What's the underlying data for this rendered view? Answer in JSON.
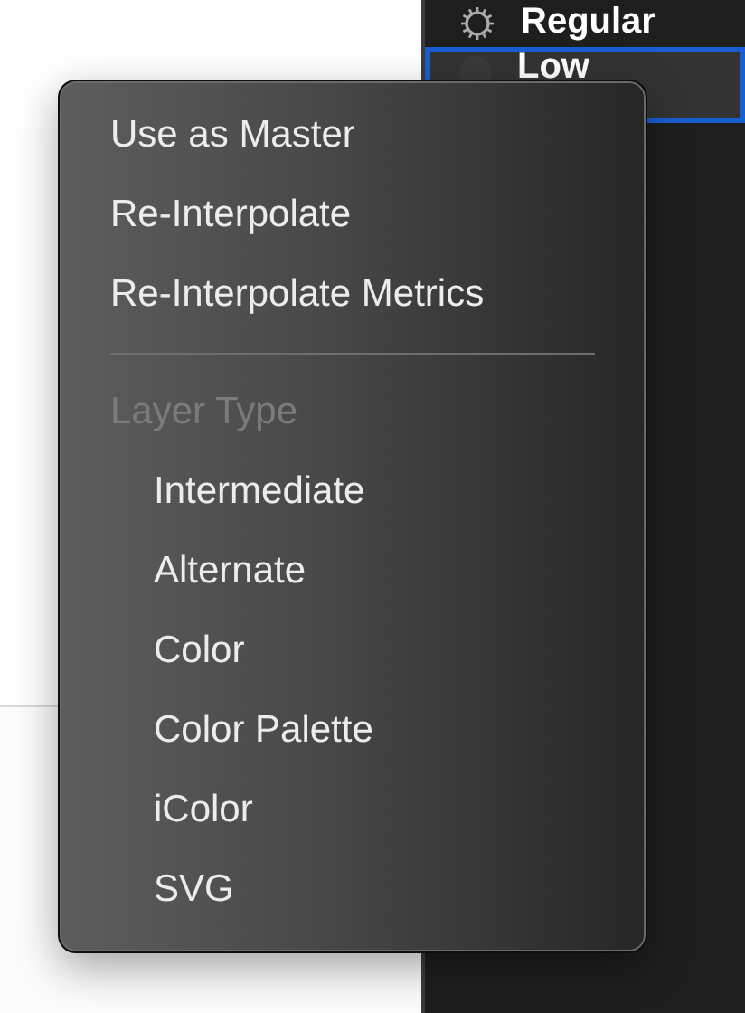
{
  "layers_panel": {
    "rows": [
      {
        "label": "Regular",
        "kind": "master",
        "selected": false
      },
      {
        "label": "Low",
        "kind": "layer",
        "selected": true
      }
    ]
  },
  "context_menu": {
    "items": [
      {
        "kind": "item",
        "label": "Use as Master"
      },
      {
        "kind": "item",
        "label": "Re-Interpolate"
      },
      {
        "kind": "item",
        "label": "Re-Interpolate Metrics"
      },
      {
        "kind": "separator"
      },
      {
        "kind": "header",
        "label": "Layer Type",
        "children": [
          {
            "label": "Intermediate"
          },
          {
            "label": "Alternate"
          },
          {
            "label": "Color"
          },
          {
            "label": "Color Palette"
          },
          {
            "label": "iColor"
          },
          {
            "label": "SVG"
          }
        ]
      }
    ]
  }
}
